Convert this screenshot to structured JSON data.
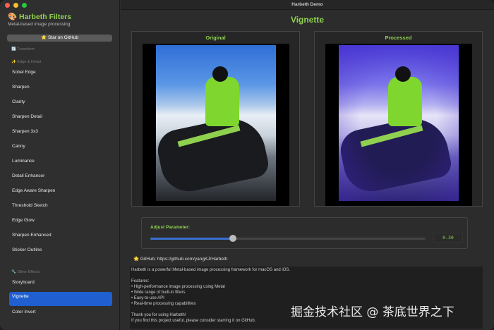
{
  "window": {
    "title": "Harbeth Demo"
  },
  "sidebar": {
    "app_title": "🎨 Harbeth Filters",
    "subtitle": "Metal-based image processing",
    "star_button": "⭐ Star on GitHub",
    "sections": [
      {
        "header": "🔄 Transform",
        "items": []
      },
      {
        "header": "✨ Edge & Detail",
        "items": [
          "Sobel Edge",
          "Sharpen",
          "Clarity",
          "Sharpen Detail",
          "Sharpen 3x3",
          "Canny",
          "Luminance",
          "Detail Enhancer",
          "Edge Aware Sharpen",
          "Threshold Sketch",
          "Edge Glow",
          "Sharpen Enhanced",
          "Sticker Outline"
        ]
      },
      {
        "header": "🔧 Other Effects",
        "items": [
          "Storyboard",
          "Vignette",
          "Color Invert"
        ]
      }
    ],
    "selected": "Vignette"
  },
  "main": {
    "title": "Vignette",
    "original_label": "Original",
    "processed_label": "Processed",
    "slider": {
      "label": "Adjust Parameter:",
      "value": 0.3,
      "value_text": "0.30",
      "min": 0,
      "max": 1
    },
    "github": "🌟 GitHub: https://github.com/yangKJ/Harbeth",
    "info_lines": [
      "Harbeth is a powerful Metal-based image processing framework for macOS and iOS.",
      "",
      "Features:",
      "• High-performance image processing using Metal",
      "• Wide range of built-in filters",
      "• Easy-to-use API",
      "• Real-time processing capabilities",
      "",
      "Thank you for using Harbeth!",
      "If you find this project useful, please consider starring it on GitHub."
    ]
  },
  "watermark": "掘金技术社区 @ 茶底世界之下",
  "colors": {
    "accent_green": "#8fd14f",
    "selection_blue": "#1f5fd0"
  }
}
